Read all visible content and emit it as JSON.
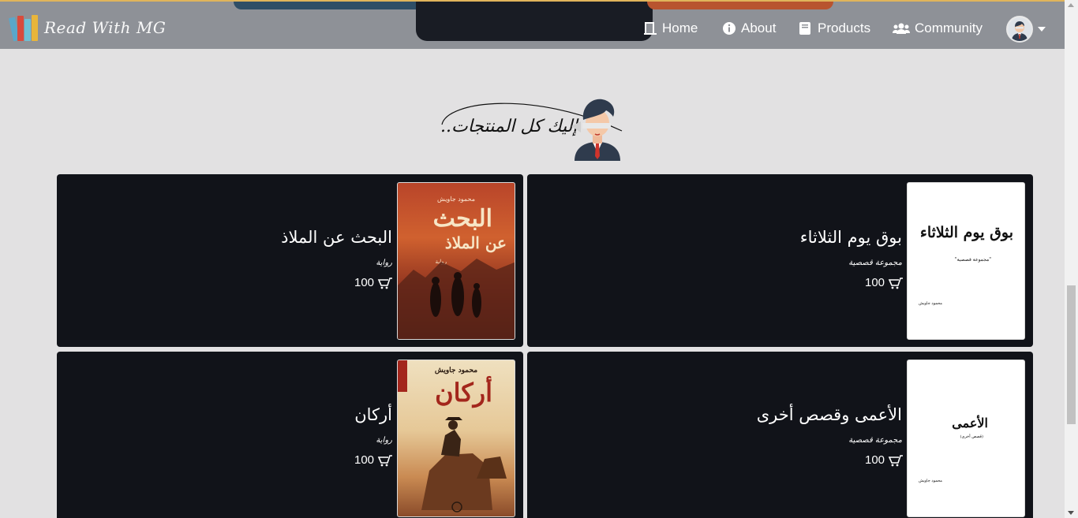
{
  "brand": {
    "name": "Read With MG"
  },
  "nav": {
    "home": "Home",
    "about": "About",
    "products": "Products",
    "community": "Community"
  },
  "section": {
    "heading": "إليك كل المنتجات.."
  },
  "products": [
    {
      "title": "بوق يوم الثلاثاء",
      "category": "مجموعة قصصية",
      "price": "100",
      "cover": {
        "title": "بوق يوم الثلاثاء",
        "subtitle": "\"مجموعة قصصية\"",
        "author": "محمود جاويش"
      }
    },
    {
      "title": "البحث عن الملاذ",
      "category": "رواية",
      "price": "100",
      "cover": {
        "top": "محمود جاويش",
        "title_line1": "البحث",
        "title_line2": "عن الملاذ",
        "tag": "رواية"
      }
    },
    {
      "title": "الأعمى وقصص أخرى",
      "category": "مجموعة قصصية",
      "price": "100",
      "cover": {
        "title": "الأعمى",
        "subtitle": "(قصص أخرى)",
        "author": "محمود جاويش"
      }
    },
    {
      "title": "أركان",
      "category": "رواية",
      "price": "100",
      "cover": {
        "top": "محمود جاويش",
        "title": "أركان"
      }
    }
  ],
  "colors": {
    "navbar": "#8e9197",
    "background": "#e2e1e2",
    "card": "#111319",
    "accent_gold": "#e0b45b"
  },
  "icons": [
    "door-icon",
    "info-icon",
    "book-icon",
    "users-icon",
    "cart-icon",
    "avatar-icon",
    "caret-down-icon"
  ]
}
